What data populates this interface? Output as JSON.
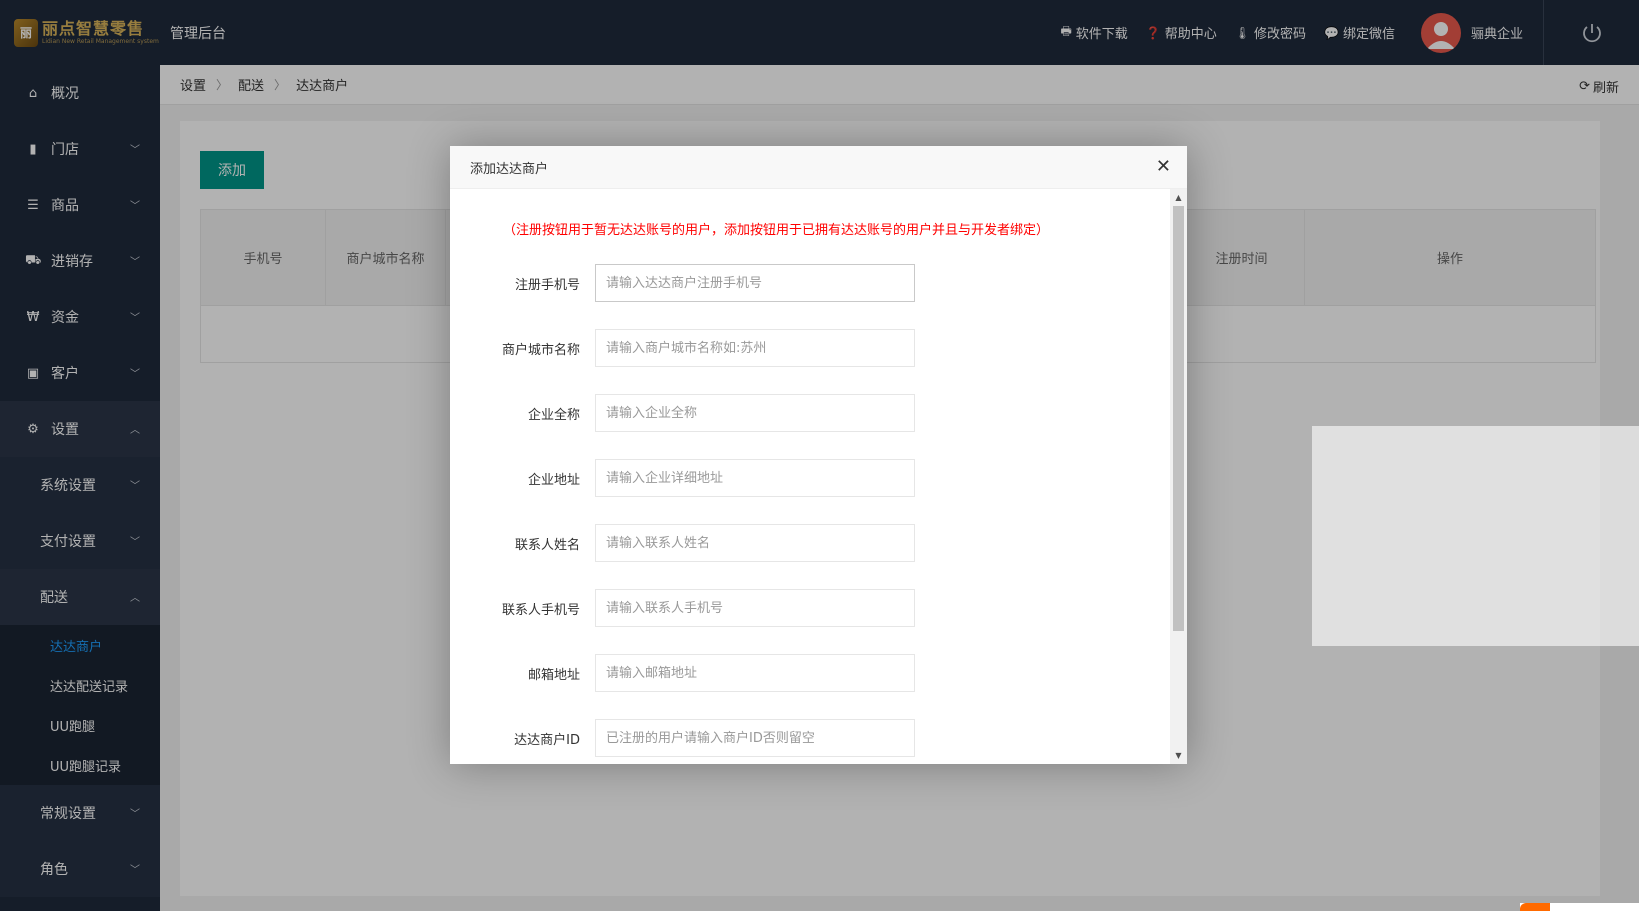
{
  "header": {
    "logo_title": "丽点智慧零售",
    "logo_sub": "Lidian New Retail Management system",
    "title": "管理后台",
    "links": [
      {
        "label": "软件下载",
        "icon": "printer-icon"
      },
      {
        "label": "帮助中心",
        "icon": "question-circle-icon"
      },
      {
        "label": "修改密码",
        "icon": "thermometer-icon"
      },
      {
        "label": "绑定微信",
        "icon": "wechat-icon"
      }
    ],
    "company": "骊典企业"
  },
  "sidebar": {
    "items": [
      {
        "label": "概况",
        "icon": "home-icon"
      },
      {
        "label": "门店",
        "icon": "building-icon"
      },
      {
        "label": "商品",
        "icon": "list-icon"
      },
      {
        "label": "进销存",
        "icon": "truck-icon"
      },
      {
        "label": "资金",
        "icon": "won-icon"
      },
      {
        "label": "客户",
        "icon": "id-card-icon"
      },
      {
        "label": "设置",
        "icon": "gear-icon"
      }
    ],
    "settings_sub": [
      {
        "label": "系统设置"
      },
      {
        "label": "支付设置"
      },
      {
        "label": "配送"
      }
    ],
    "delivery_leaves": [
      {
        "label": "达达商户"
      },
      {
        "label": "达达配送记录"
      },
      {
        "label": "UU跑腿"
      },
      {
        "label": "UU跑腿记录"
      }
    ],
    "bottom_sub": [
      {
        "label": "常规设置"
      },
      {
        "label": "角色"
      }
    ]
  },
  "breadcrumb": [
    "设置",
    "配送",
    "达达商户"
  ],
  "refresh_label": "刷新",
  "toolbar": {
    "add_label": "添加"
  },
  "table": {
    "columns": [
      "手机号",
      "商户城市名称",
      "注册时间",
      "操作"
    ]
  },
  "modal": {
    "title": "添加达达商户",
    "notice": "（注册按钮用于暂无达达账号的用户，添加按钮用于已拥有达达账号的用户并且与开发者绑定）",
    "fields": [
      {
        "label": "注册手机号",
        "placeholder": "请输入达达商户注册手机号"
      },
      {
        "label": "商户城市名称",
        "placeholder": "请输入商户城市名称如:苏州"
      },
      {
        "label": "企业全称",
        "placeholder": "请输入企业全称"
      },
      {
        "label": "企业地址",
        "placeholder": "请输入企业详细地址"
      },
      {
        "label": "联系人姓名",
        "placeholder": "请输入联系人姓名"
      },
      {
        "label": "联系人手机号",
        "placeholder": "请输入联系人手机号"
      },
      {
        "label": "邮箱地址",
        "placeholder": "请输入邮箱地址"
      },
      {
        "label": "达达商户ID",
        "placeholder": "已注册的用户请输入商户ID否则留空"
      }
    ]
  }
}
